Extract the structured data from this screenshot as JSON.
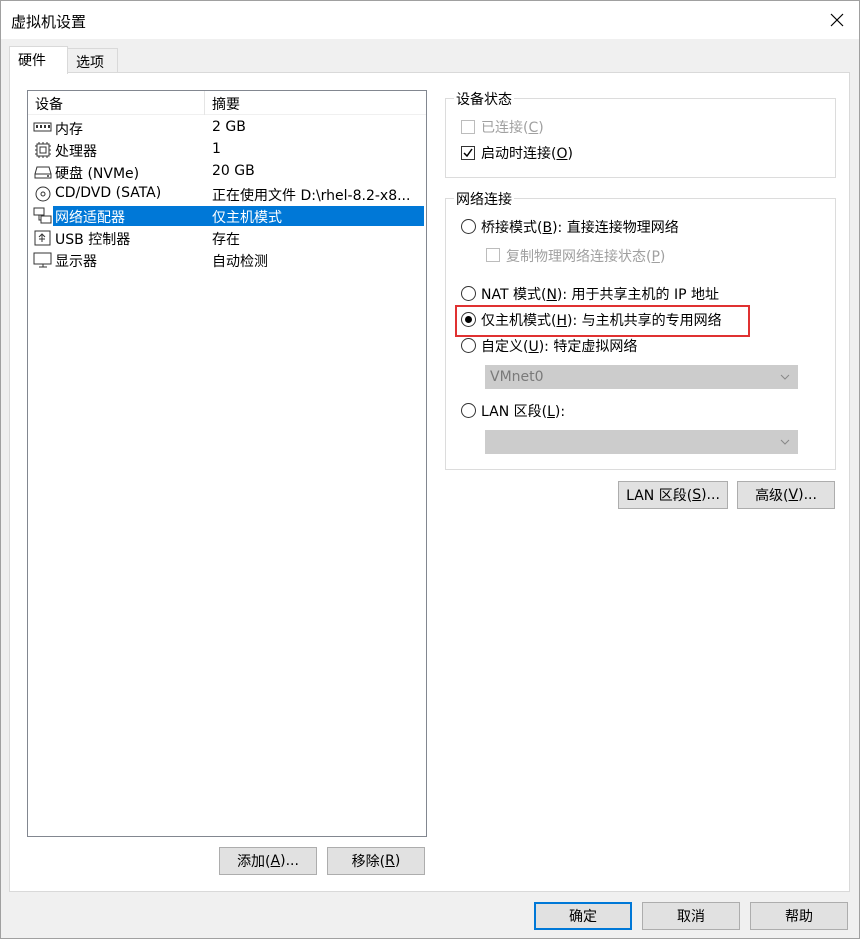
{
  "window": {
    "title": "虚拟机设置"
  },
  "tabs": [
    {
      "label": "硬件",
      "active": true
    },
    {
      "label": "选项",
      "active": false
    }
  ],
  "device_list": {
    "headers": {
      "device": "设备",
      "summary": "摘要"
    },
    "rows": [
      {
        "name": "内存",
        "summary": "2 GB",
        "icon": "memory-icon"
      },
      {
        "name": "处理器",
        "summary": "1",
        "icon": "cpu-icon"
      },
      {
        "name": "硬盘 (NVMe)",
        "summary": "20 GB",
        "icon": "harddisk-icon"
      },
      {
        "name": "CD/DVD (SATA)",
        "summary": "正在使用文件 D:\\rhel-8.2-x8...",
        "icon": "cd-icon"
      },
      {
        "name": "网络适配器",
        "summary": "仅主机模式",
        "icon": "network-icon",
        "selected": true
      },
      {
        "name": "USB 控制器",
        "summary": "存在",
        "icon": "usb-icon"
      },
      {
        "name": "显示器",
        "summary": "自动检测",
        "icon": "monitor-icon"
      }
    ]
  },
  "list_buttons": {
    "add_pre": "添加(",
    "add_key": "A",
    "add_post": ")...",
    "remove_pre": "移除(",
    "remove_key": "R",
    "remove_post": ")"
  },
  "device_status": {
    "legend": "设备状态",
    "connected": {
      "pre": "已连接(",
      "key": "C",
      "post": ")",
      "checked": false,
      "enabled": false
    },
    "connect_on_start": {
      "pre": "启动时连接(",
      "key": "O",
      "post": ")",
      "checked": true,
      "enabled": true
    }
  },
  "network": {
    "legend": "网络连接",
    "bridged": {
      "pre": "桥接模式(",
      "key": "B",
      "post": "): 直接连接物理网络",
      "selected": false
    },
    "replicate": {
      "pre": "复制物理网络连接状态(",
      "key": "P",
      "post": ")",
      "checked": false,
      "enabled": false
    },
    "nat": {
      "pre": "NAT 模式(",
      "key": "N",
      "post": "): 用于共享主机的 IP 地址",
      "selected": false
    },
    "hostonly": {
      "pre": "仅主机模式(",
      "key": "H",
      "post": "): 与主机共享的专用网络",
      "selected": true
    },
    "custom": {
      "pre": "自定义(",
      "key": "U",
      "post": "): 特定虚拟网络",
      "selected": false
    },
    "custom_combo_value": "VMnet0",
    "lan": {
      "pre": "LAN 区段(",
      "key": "L",
      "post": "):",
      "selected": false
    },
    "lan_combo_value": ""
  },
  "net_buttons": {
    "lan_pre": "LAN 区段(",
    "lan_key": "S",
    "lan_post": ")...",
    "adv_pre": "高级(",
    "adv_key": "V",
    "adv_post": ")..."
  },
  "dialog_buttons": {
    "ok": "确定",
    "cancel": "取消",
    "help": "帮助"
  },
  "colors": {
    "selection": "#0078d7",
    "highlight_box": "#e03131"
  }
}
